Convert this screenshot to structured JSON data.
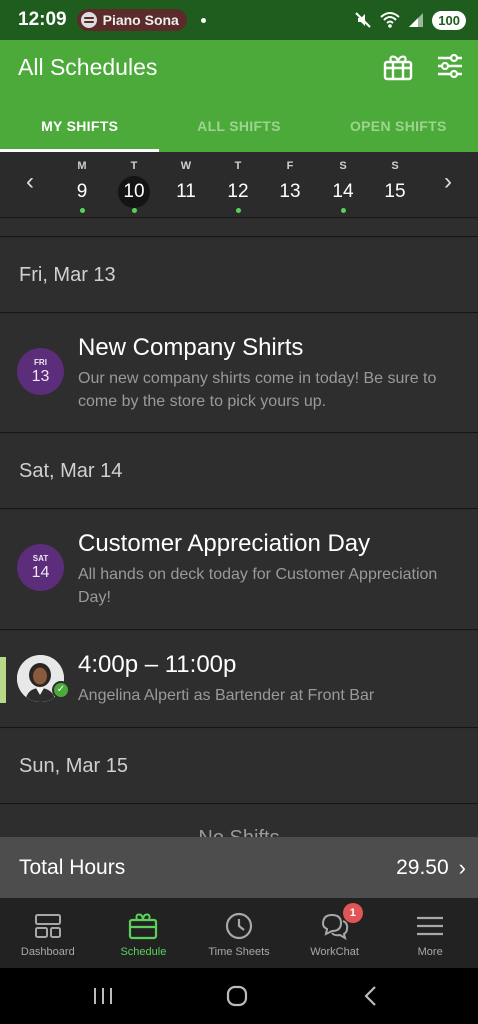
{
  "status_bar": {
    "time": "12:09",
    "media_label": "Piano Sona",
    "battery": "100"
  },
  "header": {
    "title": "All Schedules",
    "gift_icon": "gift-icon",
    "filter_icon": "sliders-icon"
  },
  "tabs": [
    {
      "label": "MY SHIFTS",
      "active": true
    },
    {
      "label": "ALL SHIFTS",
      "active": false
    },
    {
      "label": "OPEN SHIFTS",
      "active": false
    }
  ],
  "week": {
    "prev": "‹",
    "next": "›",
    "days": [
      {
        "letter": "M",
        "num": "9",
        "dot": true,
        "selected": false
      },
      {
        "letter": "T",
        "num": "10",
        "dot": true,
        "selected": true
      },
      {
        "letter": "W",
        "num": "11",
        "dot": false,
        "selected": false
      },
      {
        "letter": "T",
        "num": "12",
        "dot": true,
        "selected": false
      },
      {
        "letter": "F",
        "num": "13",
        "dot": false,
        "selected": false
      },
      {
        "letter": "S",
        "num": "14",
        "dot": true,
        "selected": false
      },
      {
        "letter": "S",
        "num": "15",
        "dot": false,
        "selected": false
      }
    ]
  },
  "list": {
    "fri_header": "Fri, Mar 13",
    "event1": {
      "badge_dow": "FRI",
      "badge_day": "13",
      "title": "New Company Shirts",
      "desc": "Our new company shirts come in today! Be sure to come by the store to pick yours up."
    },
    "sat_header": "Sat, Mar 14",
    "event2": {
      "badge_dow": "SAT",
      "badge_day": "14",
      "title": "Customer Appreciation Day",
      "desc": "All hands on deck today for Customer Appreciation Day!"
    },
    "shift": {
      "time": "4:00p – 11:00p",
      "detail": "Angelina Alperti as Bartender at Front Bar"
    },
    "sun_header": "Sun, Mar 15",
    "no_shifts": "No Shifts"
  },
  "total": {
    "label": "Total Hours",
    "value": "29.50",
    "chevron": "›"
  },
  "bottom_nav": [
    {
      "label": "Dashboard",
      "icon": "dashboard-icon"
    },
    {
      "label": "Schedule",
      "icon": "schedule-icon",
      "active": true
    },
    {
      "label": "Time Sheets",
      "icon": "clock-icon"
    },
    {
      "label": "WorkChat",
      "icon": "chat-icon",
      "badge": "1"
    },
    {
      "label": "More",
      "icon": "menu-icon"
    }
  ],
  "colors": {
    "brand_green": "#4caa3a",
    "status_green": "#1f5d1f",
    "event_purple": "#5b2d7a",
    "dot_green": "#5bd15b",
    "badge_red": "#e05555"
  }
}
